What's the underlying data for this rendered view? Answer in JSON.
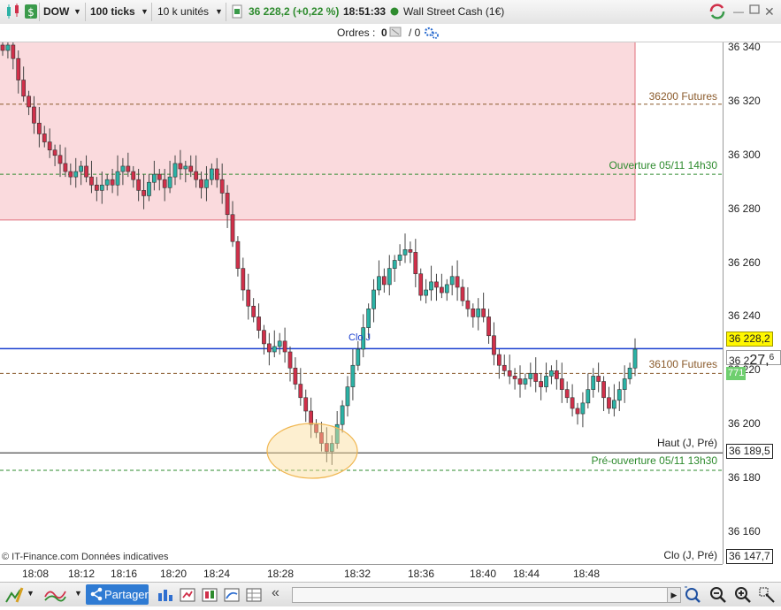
{
  "toolbar": {
    "instrument": "DOW",
    "ticks": "100 ticks",
    "units": "10 k unités",
    "price": "36 228,2 (+0,22 %)",
    "time": "18:51:33",
    "market": "Wall Street Cash (1€)"
  },
  "orders": {
    "label": "Ordres :",
    "count_a": "0",
    "count_b": "/ 0"
  },
  "y_axis": {
    "ticks": [
      "36 340",
      "36 320",
      "36 300",
      "36 280",
      "36 260",
      "36 240",
      "36 220",
      "36 200",
      "36 180",
      "36 160"
    ],
    "tag_current": "36 228,2",
    "tag_cursor_main": "27,",
    "tag_cursor_sup": "6",
    "tag_cursor_prefix": "36 2",
    "tag_green": "771",
    "tag_haut": "36 189,5",
    "tag_clo": "36 147,7"
  },
  "levels": {
    "futures_36200": "36200 Futures",
    "ouverture": "Ouverture 05/11 14h30",
    "futures_36100": "36100 Futures",
    "clo_j": "Clo J",
    "haut": "Haut (J, Pré)",
    "pre_ouverture": "Pré-ouverture 05/11 13h30",
    "clo": "Clo (J, Pré)"
  },
  "x_axis": {
    "ticks": [
      "18:08",
      "18:12",
      "18:16",
      "18:20",
      "18:24",
      "18:28",
      "18:32",
      "18:36",
      "18:40",
      "18:44",
      "18:48"
    ]
  },
  "footer_note": "© IT-Finance.com  Données indicatives",
  "bottom": {
    "share_label": "Partager"
  },
  "colors": {
    "up": "#2bb3a6",
    "down": "#d0304a",
    "zone": "#fadadd",
    "zone_border": "#e0707c",
    "price_line": "#1a3fcf",
    "futures": "#8a5a2b",
    "green": "#2e8b2e"
  },
  "chart_data": {
    "type": "candlestick",
    "y_range": [
      36140,
      36345
    ],
    "x_ticks": [
      "18:08",
      "18:12",
      "18:16",
      "18:20",
      "18:24",
      "18:28",
      "18:32",
      "18:36",
      "18:40",
      "18:44",
      "18:48"
    ],
    "zone": {
      "from": 36276,
      "to": 36345
    },
    "levels": [
      {
        "name": "36200 Futures",
        "value": 36319
      },
      {
        "name": "Ouverture 05/11 14h30",
        "value": 36293
      },
      {
        "name": "last",
        "value": 36228.2
      },
      {
        "name": "36100 Futures",
        "value": 36219
      },
      {
        "name": "Haut (J, Pré)",
        "value": 36189.5
      },
      {
        "name": "Pré-ouverture 05/11 13h30",
        "value": 36183
      },
      {
        "name": "Clo (J, Pré)",
        "value": 36147.7
      }
    ],
    "closes": [
      36339,
      36341,
      36336,
      36328,
      36322,
      36318,
      36312,
      36308,
      36305,
      36302,
      36300,
      36297,
      36294,
      36292,
      36294,
      36296,
      36292,
      36289,
      36287,
      36289,
      36291,
      36289,
      36294,
      36296,
      36294,
      36291,
      36287,
      36285,
      36290,
      36293,
      36291,
      36288,
      36292,
      36297,
      36295,
      36296,
      36294,
      36291,
      36288,
      36291,
      36295,
      36291,
      36286,
      36278,
      36268,
      36258,
      36250,
      36244,
      36240,
      36235,
      36230,
      36227,
      36229,
      36231,
      36227,
      36221,
      36215,
      36210,
      36205,
      36200,
      36197,
      36193,
      36190,
      36193,
      36200,
      36207,
      36214,
      36222,
      36228,
      36236,
      36243,
      36250,
      36255,
      36252,
      36258,
      36261,
      36263,
      36265,
      36264,
      36256,
      36248,
      36250,
      36253,
      36251,
      36249,
      36252,
      36255,
      36251,
      36246,
      36243,
      36240,
      36243,
      36240,
      36233,
      36226,
      36222,
      36220,
      36218,
      36217,
      36215,
      36217,
      36219,
      36216,
      36214,
      36218,
      36220,
      36217,
      36213,
      36210,
      36206,
      36204,
      36208,
      36213,
      36218,
      36216,
      36210,
      36206,
      36209,
      36213,
      36217,
      36221,
      36228
    ]
  }
}
